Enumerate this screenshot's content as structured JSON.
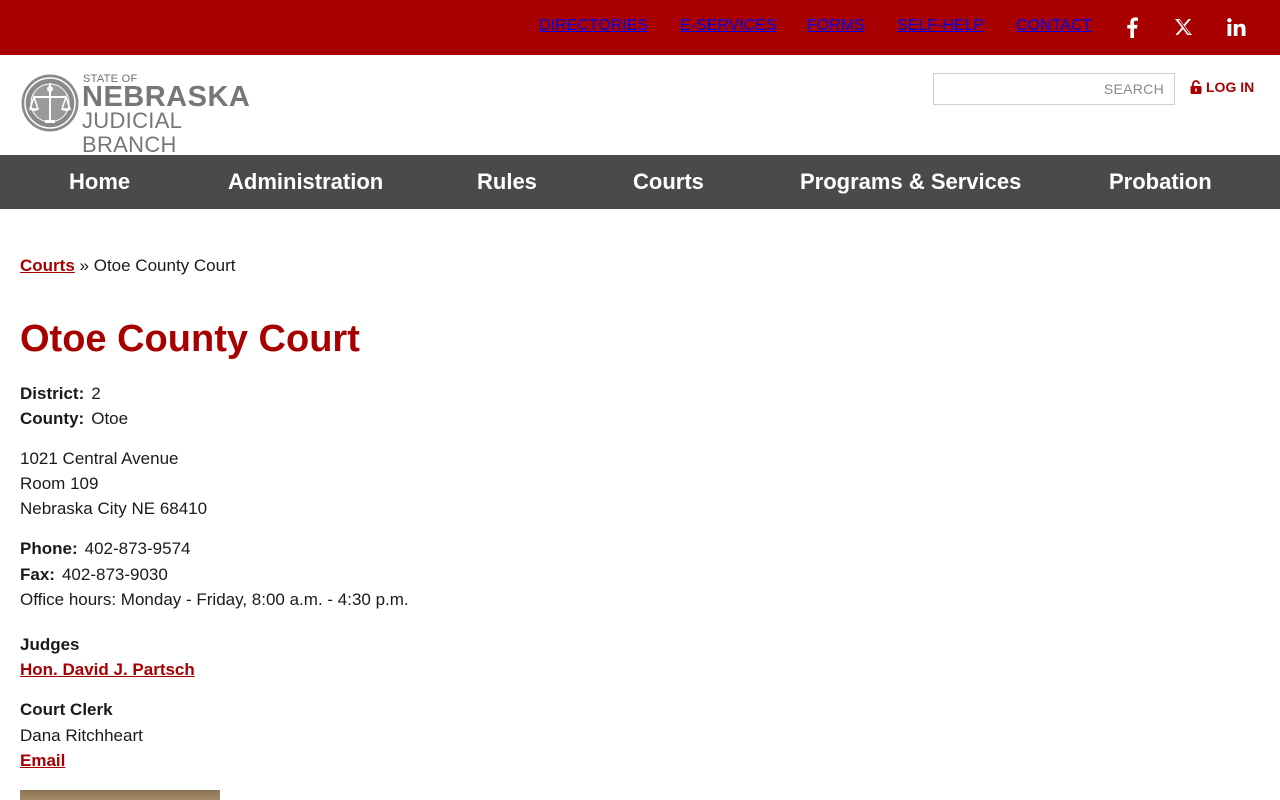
{
  "topnav": {
    "links": [
      "DIRECTORIES",
      "E-SERVICES",
      "FORMS",
      "SELF-HELP",
      "CONTACT"
    ],
    "social": [
      "facebook-icon",
      "x-twitter-icon",
      "linkedin-icon"
    ]
  },
  "logo": {
    "small": "STATE OF",
    "big": "NEBRASKA",
    "mid": "JUDICIAL BRANCH"
  },
  "search": {
    "placeholder": "SEARCH"
  },
  "login": {
    "label": "LOG IN"
  },
  "mainnav": [
    "Home",
    "Administration",
    "Rules",
    "Courts",
    "Programs & Services",
    "Probation"
  ],
  "breadcrumb": {
    "link": "Courts",
    "sep": "»",
    "current": "Otoe County Court"
  },
  "page": {
    "title": "Otoe County Court",
    "district_label": "District:",
    "district": "2",
    "county_label": "County:",
    "county": "Otoe",
    "address1": "1021 Central Avenue",
    "address2": "Room 109",
    "address3": "Nebraska City NE 68410",
    "phone_label": "Phone:",
    "phone": "402-873-9574",
    "fax_label": "Fax:",
    "fax": "402-873-9030",
    "hours": "Office hours: Monday - Friday, 8:00 a.m. - 4:30 p.m.",
    "judges_heading": "Judges",
    "judge": "Hon. David J. Partsch",
    "clerk_heading": "Court Clerk",
    "clerk": "Dana Ritchheart",
    "email": "Email"
  },
  "colors": {
    "brand_red": "#a80000",
    "nav_gray": "#4a4a4a"
  }
}
